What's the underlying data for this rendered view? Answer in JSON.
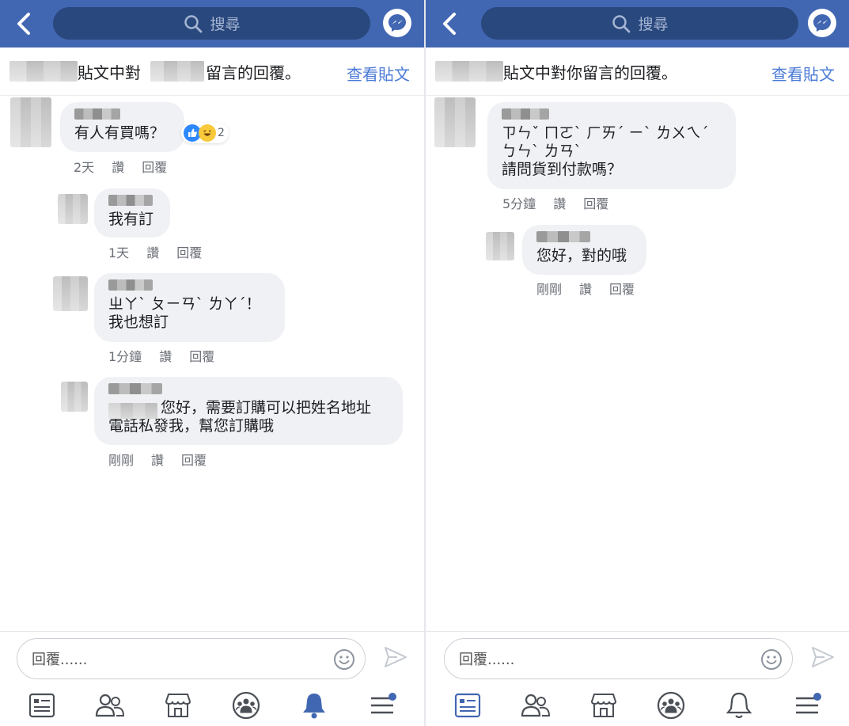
{
  "left": {
    "search_placeholder": "搜尋",
    "header": {
      "title_part1": "貼文中對",
      "title_part2": "留言的回覆。",
      "view_post": "查看貼文"
    },
    "comments": [
      {
        "text": "有人有買嗎？",
        "time": "2天",
        "like": "讚",
        "reply": "回覆",
        "reaction_count": "2"
      },
      {
        "text": "我有訂",
        "time": "1天",
        "like": "讚",
        "reply": "回覆"
      },
      {
        "text": "ㄓㄚˋ ㄆㄧㄢˋ ㄌㄚˊ！\n我也想訂",
        "time": "1分鐘",
        "like": "讚",
        "reply": "回覆"
      },
      {
        "text": "您好，需要訂購可以把姓名地址\n電話私發我，幫您訂購哦",
        "time": "剛剛",
        "like": "讚",
        "reply": "回覆"
      }
    ],
    "reply_placeholder": "回覆......"
  },
  "right": {
    "search_placeholder": "搜尋",
    "header": {
      "title": "貼文中對你留言的回覆。",
      "view_post": "查看貼文"
    },
    "comments": [
      {
        "text": "ㄗㄣˇ ㄇㄛˋ ㄏㄞˊ ㄧˋ ㄌㄨㄟˊ\nㄅㄣˋ ㄌㄢˋ\n請問貨到付款嗎？",
        "time": "5分鐘",
        "like": "讚",
        "reply": "回覆"
      },
      {
        "text": "您好，對的哦",
        "time": "剛剛",
        "like": "讚",
        "reply": "回覆"
      }
    ],
    "reply_placeholder": "回覆......"
  },
  "colors": {
    "brand": "#4267b2",
    "search_bg": "#29487d",
    "link": "#4a7ad6",
    "bubble": "#f0f1f4"
  },
  "icons": [
    "back-icon",
    "search-icon",
    "messenger-icon",
    "emoji-icon",
    "send-icon",
    "news-feed-icon",
    "friends-icon",
    "marketplace-icon",
    "groups-icon",
    "notifications-icon",
    "menu-icon"
  ]
}
